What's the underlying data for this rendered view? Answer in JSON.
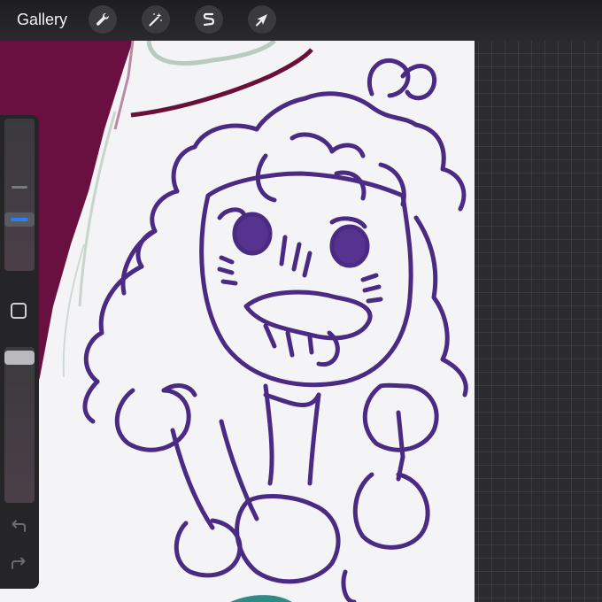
{
  "topbar": {
    "gallery_label": "Gallery",
    "tools": [
      {
        "name": "actions",
        "icon": "wrench-icon"
      },
      {
        "name": "adjustments",
        "icon": "magic-wand-icon"
      },
      {
        "name": "selection",
        "icon": "selection-s-icon"
      },
      {
        "name": "transform",
        "icon": "arrow-cursor-icon"
      }
    ]
  },
  "sidebar": {
    "brush_size": {
      "icon": "brush-size-slider",
      "level": 0.38
    },
    "modify_button": {
      "icon": "square-icon"
    },
    "opacity": {
      "icon": "opacity-slider",
      "level": 1.0
    },
    "undo": {
      "icon": "undo-arrow-icon"
    },
    "redo": {
      "icon": "redo-arrow-icon"
    }
  },
  "colors": {
    "canvas": "#f4f4f6",
    "sketch": "#4b2a84",
    "background_fill": "#6a1040",
    "accent_blue": "#2f7cf6"
  }
}
